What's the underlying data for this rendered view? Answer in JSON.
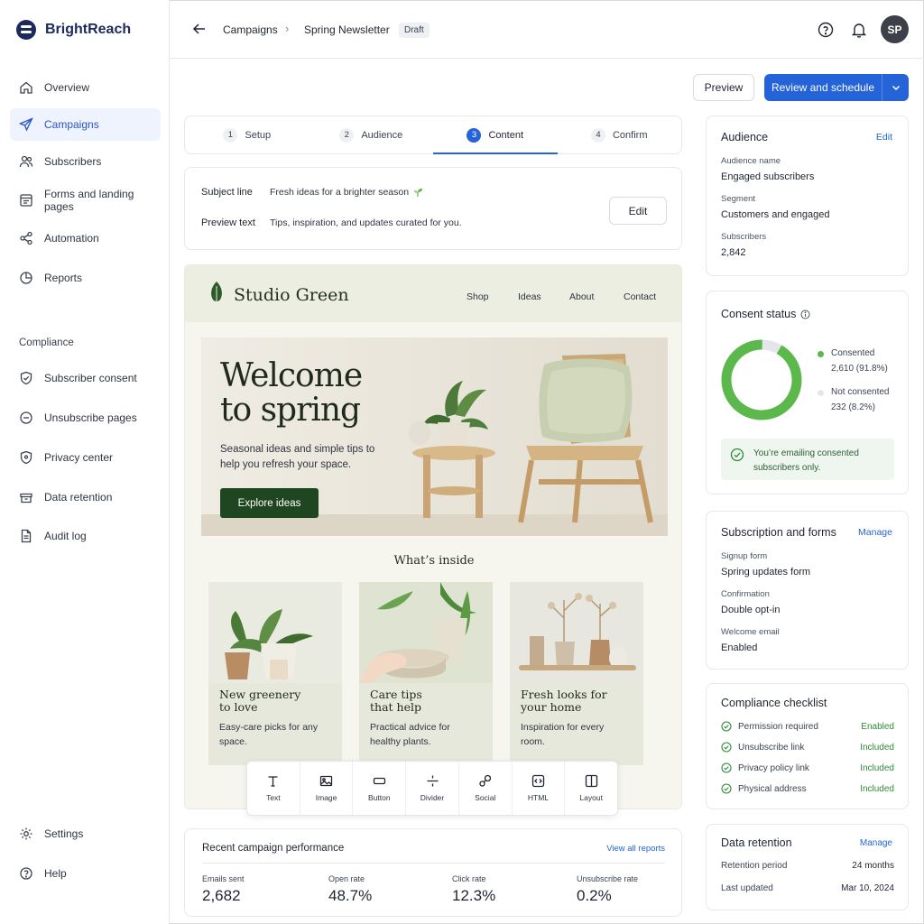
{
  "app": {
    "brand": "BrightReach"
  },
  "sidebar": {
    "items": [
      {
        "label": "Overview"
      },
      {
        "label": "Campaigns"
      },
      {
        "label": "Subscribers"
      },
      {
        "label": "Forms and landing pages"
      },
      {
        "label": "Automation"
      },
      {
        "label": "Reports"
      }
    ],
    "compliance_heading": "Compliance",
    "compliance_items": [
      {
        "label": "Subscriber consent"
      },
      {
        "label": "Unsubscribe pages"
      },
      {
        "label": "Privacy center"
      },
      {
        "label": "Data retention"
      },
      {
        "label": "Audit log"
      }
    ],
    "footer_items": [
      {
        "label": "Settings"
      },
      {
        "label": "Help"
      }
    ]
  },
  "header": {
    "breadcrumb_parent": "Campaigns",
    "breadcrumb_current": "Spring Newsletter",
    "status_badge": "Draft",
    "avatar_initials": "SP"
  },
  "actions": {
    "preview": "Preview",
    "primary": "Review and schedule"
  },
  "steps": [
    {
      "num": "1",
      "label": "Setup"
    },
    {
      "num": "2",
      "label": "Audience"
    },
    {
      "num": "3",
      "label": "Content"
    },
    {
      "num": "4",
      "label": "Confirm"
    }
  ],
  "subject": {
    "subject_label": "Subject line",
    "subject_value": "Fresh ideas for a brighter season",
    "preview_label": "Preview text",
    "preview_value": "Tips, inspiration, and updates curated for you.",
    "edit": "Edit"
  },
  "email": {
    "brand": "Studio Green",
    "nav": [
      "Shop",
      "Ideas",
      "About",
      "Contact"
    ],
    "hero_title_1": "Welcome",
    "hero_title_2": "to spring",
    "hero_sub": "Seasonal ideas and simple tips to help you refresh your space.",
    "hero_cta": "Explore ideas",
    "inside_heading": "What’s inside",
    "tiles": [
      {
        "title_1": "New greenery",
        "title_2": "to love",
        "desc": "Easy-care picks for any space."
      },
      {
        "title_1": "Care tips",
        "title_2": "that help",
        "desc": "Practical advice for healthy plants."
      },
      {
        "title_1": "Fresh looks for",
        "title_2": "your home",
        "desc": "Inspiration for every room."
      }
    ]
  },
  "toolbar": [
    "Text",
    "Image",
    "Button",
    "Divider",
    "Social",
    "HTML",
    "Layout"
  ],
  "performance": {
    "title": "Recent campaign performance",
    "link": "View all reports",
    "metrics": [
      {
        "label": "Emails sent",
        "value": "2,682"
      },
      {
        "label": "Open rate",
        "value": "48.7%"
      },
      {
        "label": "Click rate",
        "value": "12.3%"
      },
      {
        "label": "Unsubscribe rate",
        "value": "0.2%"
      }
    ]
  },
  "audience": {
    "title": "Audience",
    "link": "Edit",
    "name_label": "Audience name",
    "name_value": "Engaged subscribers",
    "segment_label": "Segment",
    "segment_value": "Customers and engaged",
    "subs_label": "Subscribers",
    "subs_value": "2,842"
  },
  "consent": {
    "title": "Consent status",
    "consented_label": "Consented",
    "consented_value": "2,610 (91.8%)",
    "consented_fraction": 0.918,
    "not_label": "Not consented",
    "not_value": "232 (8.2%)",
    "notice": "You’re emailing consented subscribers only.",
    "colors": {
      "consented": "#5cb84a",
      "not": "#e4e6e9"
    }
  },
  "subscription": {
    "title": "Subscription and forms",
    "link": "Manage",
    "signup_label": "Signup form",
    "signup_value": "Spring updates form",
    "confirm_label": "Confirmation",
    "confirm_value": "Double opt-in",
    "welcome_label": "Welcome email",
    "welcome_value": "Enabled"
  },
  "checklist": {
    "title": "Compliance checklist",
    "items": [
      {
        "label": "Permission required",
        "status": "Enabled"
      },
      {
        "label": "Unsubscribe link",
        "status": "Included"
      },
      {
        "label": "Privacy policy link",
        "status": "Included"
      },
      {
        "label": "Physical address",
        "status": "Included"
      }
    ]
  },
  "retention": {
    "title": "Data retention",
    "link": "Manage",
    "period_label": "Retention period",
    "period_value": "24 months",
    "updated_label": "Last updated",
    "updated_value": "Mar 10, 2024"
  },
  "theme": {
    "accent": "#2563d9",
    "brand_dark": "#1c2a5e",
    "success": "#2e8a3a"
  }
}
